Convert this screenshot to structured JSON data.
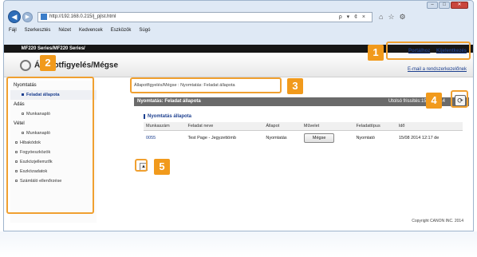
{
  "browser": {
    "url": "http://192.168.0.215/j_pjlst.html",
    "addr_tools": "ρ ▾ ¢ ×",
    "window_buttons": [
      "–",
      "□",
      "✕"
    ],
    "right_icons": [
      "⌂",
      "☆",
      "⚙"
    ],
    "menu": [
      "Fájl",
      "Szerkesztés",
      "Nézet",
      "Kedvencek",
      "Eszközök",
      "Súgó"
    ]
  },
  "canon_bar": {
    "logo": "",
    "model": "MF220 Series/MF220 Series/"
  },
  "header": {
    "title": "Állapotfigyelés/Mégse",
    "portal_link": "Portálhoz",
    "logout_link": "Kijelentkezés",
    "email_link": "E-mail a rendszerkezelőnek"
  },
  "sidebar": {
    "groups": [
      {
        "label": "Nyomtatás",
        "items": [
          "Feladat állapota"
        ]
      },
      {
        "label": "Adás",
        "items": [
          "Munkanapló"
        ]
      },
      {
        "label": "Vétel",
        "items": [
          "Munkanapló"
        ]
      }
    ],
    "links": [
      "Hibakódok",
      "Fogyóeszközök",
      "Eszközjellemzők",
      "Eszközadatok",
      "Számláló ellenőrzése"
    ]
  },
  "main": {
    "breadcrumb": "Állapotfigyelés/Mégse : Nyomtatás: Feladat állapota",
    "section_title": "Nyomtatás: Feladat állapota",
    "updated": "Utolsó frissítés:15/08 2014",
    "refresh_icon": "⟳",
    "panel_title": "Nyomtatás állapota",
    "columns": [
      "Munkaszám",
      "Feladat neve",
      "Állapot",
      "Művelet",
      "Feladattípus",
      "Idő"
    ],
    "rows": [
      {
        "job_no": "0055",
        "name": "Test Page - Jegyzettömb",
        "status": "Nyomtatás",
        "action": "Mégse",
        "type": "Nyomtató",
        "time": "15/08 2014 12:17 de"
      }
    ],
    "page_top_icon": "▲"
  },
  "footer": {
    "copyright": "Copyright CANON INC. 2014"
  },
  "callouts": [
    "1",
    "2",
    "3",
    "4",
    "5"
  ],
  "colors": {
    "callout": "#f19a1c",
    "link": "#1c3f8f",
    "section_bar": "#6a6a6a"
  }
}
